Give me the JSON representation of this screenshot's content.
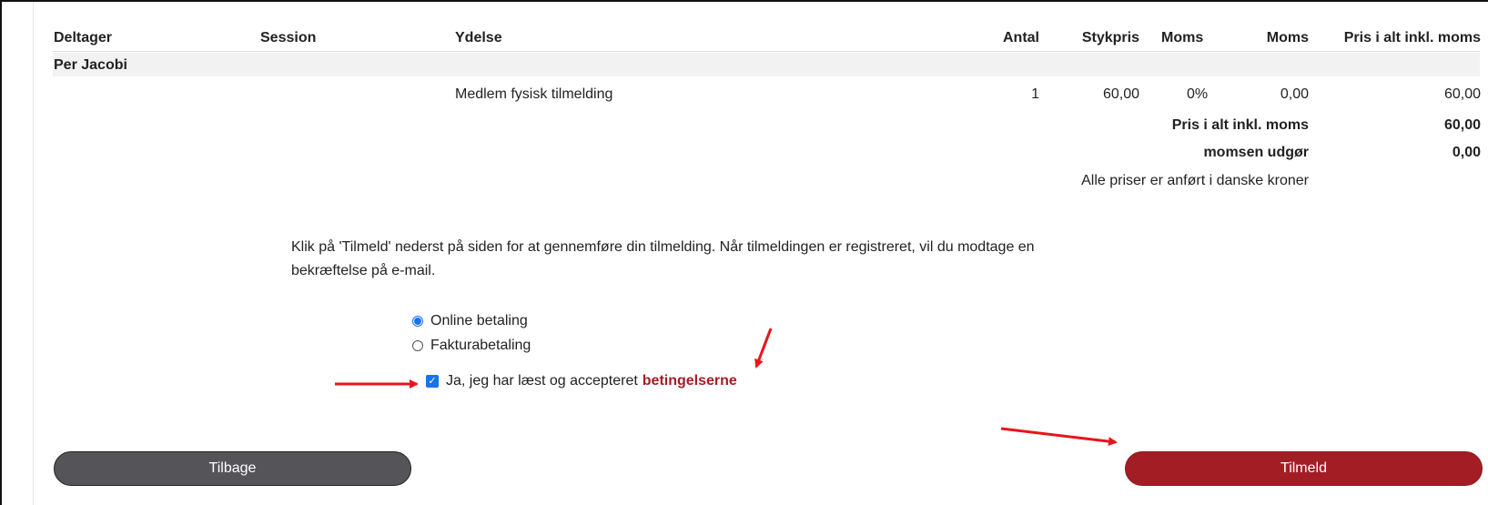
{
  "table": {
    "headers": {
      "participant": "Deltager",
      "session": "Session",
      "service": "Ydelse",
      "qty": "Antal",
      "unit_price": "Stykpris",
      "vat_rate": "Moms",
      "vat_amount": "Moms",
      "total": "Pris i alt inkl. moms"
    },
    "participant_name": "Per Jacobi",
    "rows": [
      {
        "service": "Medlem fysisk tilmelding",
        "qty": "1",
        "unit_price": "60,00",
        "vat_rate": "0%",
        "vat_amount": "0,00",
        "total": "60,00"
      }
    ],
    "summary": {
      "total_label": "Pris i alt inkl. moms",
      "total_value": "60,00",
      "vat_label": "momsen udgør",
      "vat_value": "0,00",
      "currency_note": "Alle priser er anført i danske kroner"
    }
  },
  "instructions": {
    "line1": "Klik på 'Tilmeld' nederst på siden for at gennemføre din tilmelding. Når tilmeldingen er registreret, vil du modtage en",
    "line2": "bekræftelse på e-mail."
  },
  "payment": {
    "options": [
      {
        "label": "Online betaling",
        "selected": true
      },
      {
        "label": "Fakturabetaling",
        "selected": false
      }
    ]
  },
  "terms": {
    "text": "Ja, jeg har læst og accepteret",
    "link": "betingelserne",
    "checked": true
  },
  "buttons": {
    "back": "Tilbage",
    "submit": "Tilmeld"
  },
  "colors": {
    "accent_red": "#a31d24",
    "button_grey": "#555459",
    "control_blue": "#1a73e8",
    "annotation_arrow": "#e8141b"
  }
}
